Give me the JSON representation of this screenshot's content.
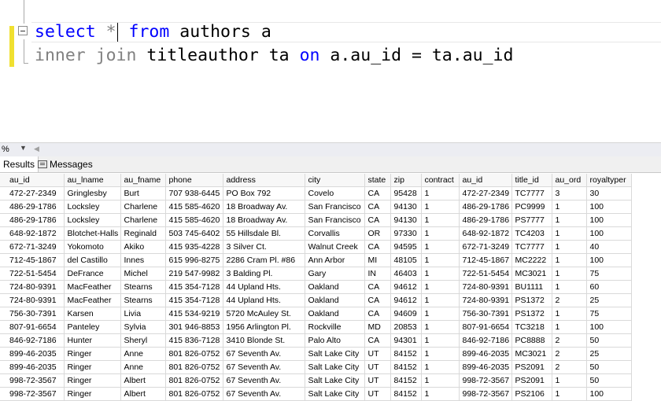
{
  "editor": {
    "line1": {
      "kw1": "select",
      "star": "*",
      "kw2": "from",
      "rest": "authors a"
    },
    "line2": {
      "kw1": "inner join",
      "mid": "titleauthor ta",
      "kw2": "on",
      "rest": "a.au_id = ta.au_id"
    }
  },
  "status": {
    "zoom": "%"
  },
  "tabs": {
    "results": "Results",
    "messages": "Messages"
  },
  "grid": {
    "columns": [
      "au_id",
      "au_lname",
      "au_fname",
      "phone",
      "address",
      "city",
      "state",
      "zip",
      "contract",
      "au_id",
      "title_id",
      "au_ord",
      "royaltyper"
    ],
    "rows": [
      [
        "472-27-2349",
        "Gringlesby",
        "Burt",
        "707 938-6445",
        "PO Box 792",
        "Covelo",
        "CA",
        "95428",
        "1",
        "472-27-2349",
        "TC7777",
        "3",
        "30"
      ],
      [
        "486-29-1786",
        "Locksley",
        "Charlene",
        "415 585-4620",
        "18 Broadway Av.",
        "San Francisco",
        "CA",
        "94130",
        "1",
        "486-29-1786",
        "PC9999",
        "1",
        "100"
      ],
      [
        "486-29-1786",
        "Locksley",
        "Charlene",
        "415 585-4620",
        "18 Broadway Av.",
        "San Francisco",
        "CA",
        "94130",
        "1",
        "486-29-1786",
        "PS7777",
        "1",
        "100"
      ],
      [
        "648-92-1872",
        "Blotchet-Halls",
        "Reginald",
        "503 745-6402",
        "55 Hillsdale Bl.",
        "Corvallis",
        "OR",
        "97330",
        "1",
        "648-92-1872",
        "TC4203",
        "1",
        "100"
      ],
      [
        "672-71-3249",
        "Yokomoto",
        "Akiko",
        "415 935-4228",
        "3 Silver Ct.",
        "Walnut Creek",
        "CA",
        "94595",
        "1",
        "672-71-3249",
        "TC7777",
        "1",
        "40"
      ],
      [
        "712-45-1867",
        "del Castillo",
        "Innes",
        "615 996-8275",
        "2286 Cram Pl. #86",
        "Ann Arbor",
        "MI",
        "48105",
        "1",
        "712-45-1867",
        "MC2222",
        "1",
        "100"
      ],
      [
        "722-51-5454",
        "DeFrance",
        "Michel",
        "219 547-9982",
        "3 Balding Pl.",
        "Gary",
        "IN",
        "46403",
        "1",
        "722-51-5454",
        "MC3021",
        "1",
        "75"
      ],
      [
        "724-80-9391",
        "MacFeather",
        "Stearns",
        "415 354-7128",
        "44 Upland Hts.",
        "Oakland",
        "CA",
        "94612",
        "1",
        "724-80-9391",
        "BU1111",
        "1",
        "60"
      ],
      [
        "724-80-9391",
        "MacFeather",
        "Stearns",
        "415 354-7128",
        "44 Upland Hts.",
        "Oakland",
        "CA",
        "94612",
        "1",
        "724-80-9391",
        "PS1372",
        "2",
        "25"
      ],
      [
        "756-30-7391",
        "Karsen",
        "Livia",
        "415 534-9219",
        "5720 McAuley St.",
        "Oakland",
        "CA",
        "94609",
        "1",
        "756-30-7391",
        "PS1372",
        "1",
        "75"
      ],
      [
        "807-91-6654",
        "Panteley",
        "Sylvia",
        "301 946-8853",
        "1956 Arlington Pl.",
        "Rockville",
        "MD",
        "20853",
        "1",
        "807-91-6654",
        "TC3218",
        "1",
        "100"
      ],
      [
        "846-92-7186",
        "Hunter",
        "Sheryl",
        "415 836-7128",
        "3410 Blonde St.",
        "Palo Alto",
        "CA",
        "94301",
        "1",
        "846-92-7186",
        "PC8888",
        "2",
        "50"
      ],
      [
        "899-46-2035",
        "Ringer",
        "Anne",
        "801 826-0752",
        "67 Seventh Av.",
        "Salt Lake City",
        "UT",
        "84152",
        "1",
        "899-46-2035",
        "MC3021",
        "2",
        "25"
      ],
      [
        "899-46-2035",
        "Ringer",
        "Anne",
        "801 826-0752",
        "67 Seventh Av.",
        "Salt Lake City",
        "UT",
        "84152",
        "1",
        "899-46-2035",
        "PS2091",
        "2",
        "50"
      ],
      [
        "998-72-3567",
        "Ringer",
        "Albert",
        "801 826-0752",
        "67 Seventh Av.",
        "Salt Lake City",
        "UT",
        "84152",
        "1",
        "998-72-3567",
        "PS2091",
        "1",
        "50"
      ],
      [
        "998-72-3567",
        "Ringer",
        "Albert",
        "801 826-0752",
        "67 Seventh Av.",
        "Salt Lake City",
        "UT",
        "84152",
        "1",
        "998-72-3567",
        "PS2106",
        "1",
        "100"
      ]
    ]
  }
}
